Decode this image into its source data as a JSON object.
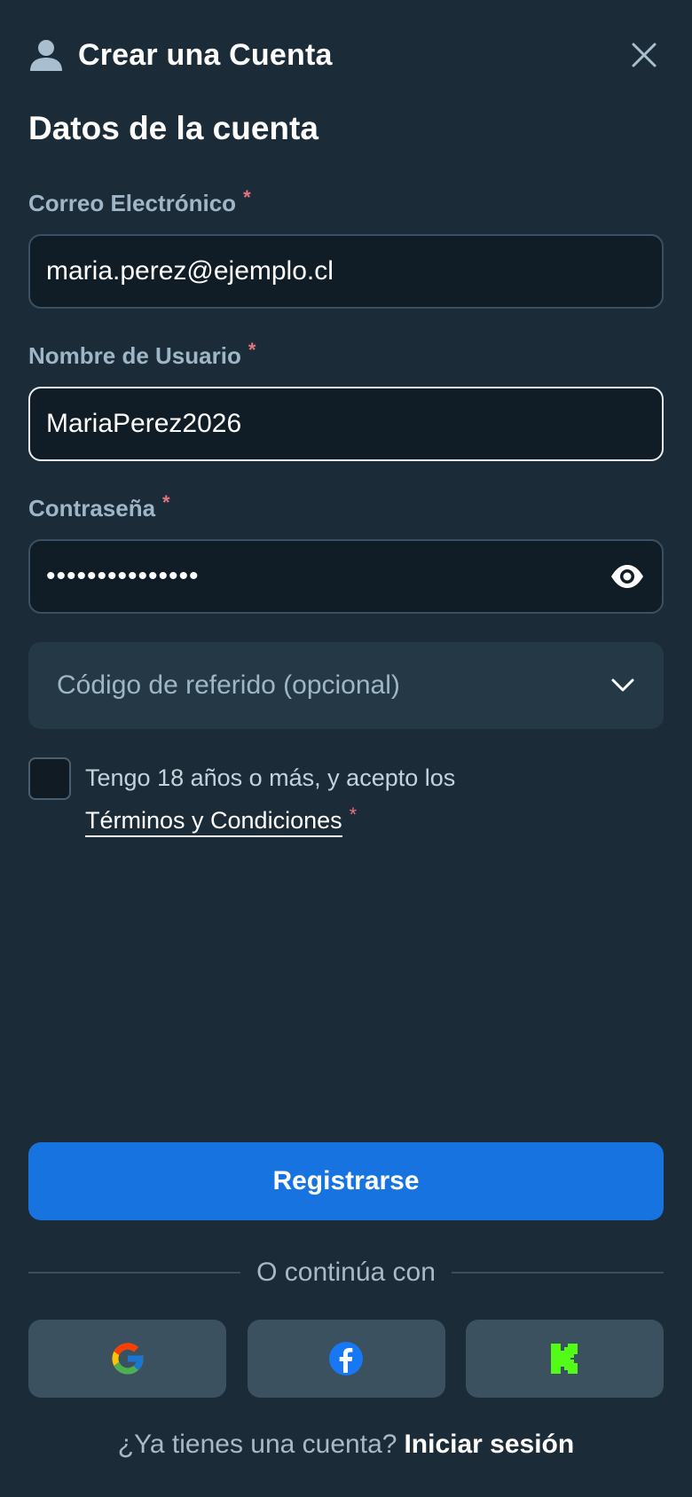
{
  "header": {
    "title": "Crear una Cuenta",
    "user_icon": "user-icon",
    "close_icon": "close-icon"
  },
  "section_title": "Datos de la cuenta",
  "form": {
    "email": {
      "label": "Correo Electrónico",
      "required_mark": "*",
      "value": "maria.perez@ejemplo.cl"
    },
    "username": {
      "label": "Nombre de Usuario",
      "required_mark": "*",
      "value": "MariaPerez2026"
    },
    "password": {
      "label": "Contraseña",
      "required_mark": "*",
      "value": "•••••••••••••••",
      "eye_icon": "eye-icon"
    },
    "referral": {
      "label": "Código de referido (opcional)",
      "chevron_icon": "chevron-down-icon"
    },
    "terms": {
      "text": "Tengo 18 años o más, y acepto los",
      "link": "Términos y Condiciones",
      "required_mark": "*",
      "checked": false
    }
  },
  "register_button": "Registrarse",
  "divider_text": "O continúa con",
  "social": [
    "google-icon",
    "facebook-icon",
    "kick-icon"
  ],
  "login_prompt": {
    "text": "¿Ya tienes una cuenta?",
    "link": "Iniciar sesión"
  },
  "colors": {
    "background": "#1b2c38",
    "accent": "#1773e0",
    "required": "#e8737f",
    "kick": "#53fc18"
  }
}
